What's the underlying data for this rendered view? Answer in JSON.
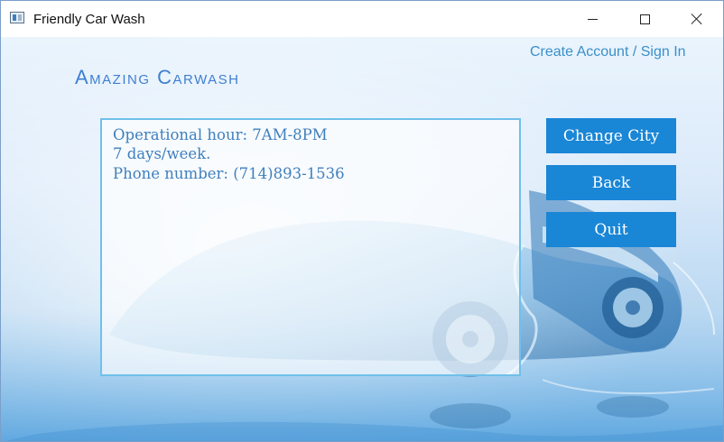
{
  "window": {
    "title": "Friendly Car Wash",
    "icon": "app-window-icon",
    "controls": [
      "minimize-icon",
      "maximize-icon",
      "close-icon"
    ]
  },
  "header": {
    "account_link": "Create Account / Sign In",
    "brand": "Amazing Carwash"
  },
  "info": {
    "lines": [
      "Operational hour: 7AM-8PM",
      "7 days/week.",
      "Phone number: (714)893-1536"
    ]
  },
  "actions": {
    "change_city": "Change City",
    "back": "Back",
    "quit": "Quit"
  },
  "colors": {
    "accent": "#1a86d6",
    "link": "#3a8fc9",
    "brand": "#3f7fd0",
    "info_text": "#3f7fbd"
  }
}
